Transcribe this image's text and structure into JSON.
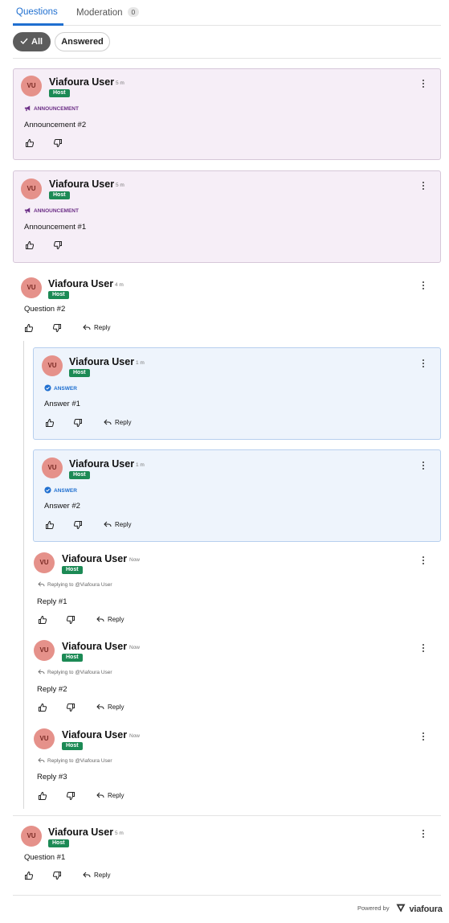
{
  "tabs": {
    "questions_label": "Questions",
    "moderation_label": "Moderation",
    "moderation_count": "0"
  },
  "filters": {
    "all_label": "All",
    "answered_label": "Answered"
  },
  "posts": [
    {
      "initials": "VU",
      "name": "Viafoura User",
      "time": "5 m",
      "badge": "Host",
      "tag": "ANNOUNCEMENT",
      "text": "Announcement #2"
    },
    {
      "initials": "VU",
      "name": "Viafoura User",
      "time": "5 m",
      "badge": "Host",
      "tag": "ANNOUNCEMENT",
      "text": "Announcement #1"
    },
    {
      "initials": "VU",
      "name": "Viafoura User",
      "time": "4 m",
      "badge": "Host",
      "text": "Question #2",
      "reply_label": "Reply"
    },
    {
      "initials": "VU",
      "name": "Viafoura User",
      "time": "1 m",
      "badge": "Host",
      "tag": "ANSWER",
      "text": "Answer #1",
      "reply_label": "Reply"
    },
    {
      "initials": "VU",
      "name": "Viafoura User",
      "time": "1 m",
      "badge": "Host",
      "tag": "ANSWER",
      "text": "Answer #2",
      "reply_label": "Reply"
    },
    {
      "initials": "VU",
      "name": "Viafoura User",
      "time": "Now",
      "badge": "Host",
      "replying_to": "Replying to @Viafoura User",
      "text": "Reply #1",
      "reply_label": "Reply"
    },
    {
      "initials": "VU",
      "name": "Viafoura User",
      "time": "Now",
      "badge": "Host",
      "replying_to": "Replying to @Viafoura User",
      "text": "Reply #2",
      "reply_label": "Reply"
    },
    {
      "initials": "VU",
      "name": "Viafoura User",
      "time": "Now",
      "badge": "Host",
      "replying_to": "Replying to @Viafoura User",
      "text": "Reply #3",
      "reply_label": "Reply"
    },
    {
      "initials": "VU",
      "name": "Viafoura User",
      "time": "5 m",
      "badge": "Host",
      "text": "Question #1",
      "reply_label": "Reply"
    }
  ],
  "footer": {
    "powered_by": "Powered by",
    "brand": "viafoura"
  },
  "colors": {
    "accent": "#1f6fd0",
    "host_badge": "#1c8a55",
    "avatar": "#e5918a",
    "announcement_bg": "#f6eef7",
    "answer_bg": "#eef4fc",
    "announcement_text": "#6b2d86"
  }
}
